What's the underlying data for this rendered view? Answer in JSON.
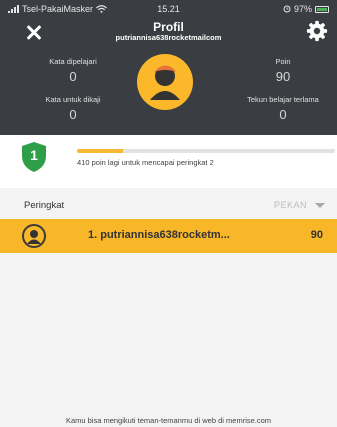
{
  "status_bar": {
    "carrier": "Tsel-PakaiMasker",
    "time": "15.21",
    "battery": "97%"
  },
  "header": {
    "title": "Profil",
    "subtitle": "putriannisa638rocketmailcom"
  },
  "stats": {
    "learned": {
      "label": "Kata dipelajari",
      "value": "0"
    },
    "review": {
      "label": "Kata untuk dikaji",
      "value": "0"
    },
    "points": {
      "label": "Poin",
      "value": "90"
    },
    "streak": {
      "label": "Tekun belajar terlama",
      "value": "0"
    }
  },
  "progress": {
    "rank": "1",
    "fraction": 0.18,
    "text": "410 poin lagi untuk mencapai peringkat 2"
  },
  "leaderboard": {
    "title": "Peringkat",
    "period": "PEKAN",
    "rows": [
      {
        "name": "1. putriannisa638rocketm...",
        "score": "90"
      }
    ]
  },
  "footer": {
    "text": "Kamu bisa mengikuti teman-temanmu di web di memrise.com"
  },
  "colors": {
    "header_bg": "#3a3d42",
    "accent": "#f8b629",
    "shield": "#2e9e48"
  },
  "icons": {
    "close": "close-icon",
    "settings": "gear-icon",
    "avatar": "user-avatar-icon",
    "rank": "shield-icon",
    "dropdown": "caret-down-icon"
  }
}
